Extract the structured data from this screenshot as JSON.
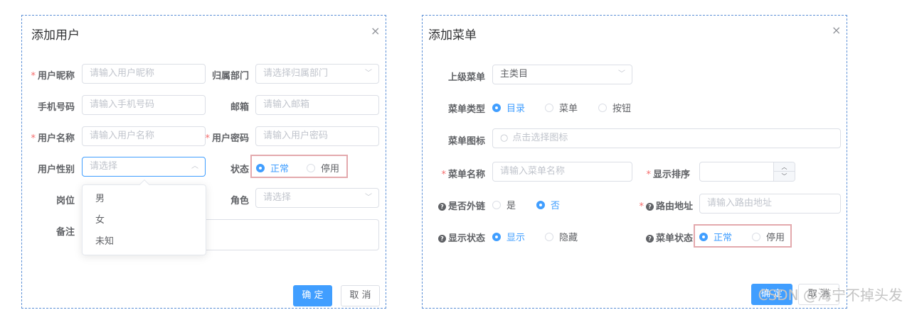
{
  "user_dialog": {
    "title": "添加用户",
    "close": "×",
    "fields": {
      "nickname": {
        "label": "用户昵称",
        "placeholder": "请输入用户昵称"
      },
      "dept": {
        "label": "归属部门",
        "placeholder": "请选择归属部门"
      },
      "phone": {
        "label": "手机号码",
        "placeholder": "请输入手机号码"
      },
      "email": {
        "label": "邮箱",
        "placeholder": "请输入邮箱"
      },
      "username": {
        "label": "用户名称",
        "placeholder": "请输入用户名称"
      },
      "password": {
        "label": "用户密码",
        "placeholder": "请输入用户密码"
      },
      "gender": {
        "label": "用户性别",
        "placeholder": "请选择"
      },
      "status": {
        "label": "状态",
        "options": [
          "正常",
          "停用"
        ],
        "selected": "正常"
      },
      "post": {
        "label": "岗位"
      },
      "role": {
        "label": "角色",
        "placeholder": "请选择"
      },
      "remark": {
        "label": "备注"
      }
    },
    "gender_options": [
      "男",
      "女",
      "未知"
    ],
    "buttons": {
      "confirm": "确 定",
      "cancel": "取 消"
    }
  },
  "menu_dialog": {
    "title": "添加菜单",
    "close": "×",
    "fields": {
      "parent": {
        "label": "上级菜单",
        "value": "主类目"
      },
      "type": {
        "label": "菜单类型",
        "options": [
          "目录",
          "菜单",
          "按钮"
        ],
        "selected": "目录"
      },
      "icon": {
        "label": "菜单图标",
        "placeholder": "点击选择图标"
      },
      "name": {
        "label": "菜单名称",
        "placeholder": "请输入菜单名称"
      },
      "order": {
        "label": "显示排序"
      },
      "external": {
        "label": "是否外链",
        "options": [
          "是",
          "否"
        ],
        "selected": "否"
      },
      "path": {
        "label": "路由地址",
        "placeholder": "请输入路由地址"
      },
      "visible": {
        "label": "显示状态",
        "options": [
          "显示",
          "隐藏"
        ],
        "selected": "显示"
      },
      "menu_status": {
        "label": "菜单状态",
        "options": [
          "正常",
          "停用"
        ],
        "selected": "正常"
      }
    },
    "buttons": {
      "confirm": "确 定",
      "cancel": "取 消"
    }
  },
  "watermark": "CSDN @海宁不掉头发",
  "colors": {
    "primary": "#409eff",
    "highlight_box": "#e3a9ad",
    "required": "#f56c6c"
  }
}
